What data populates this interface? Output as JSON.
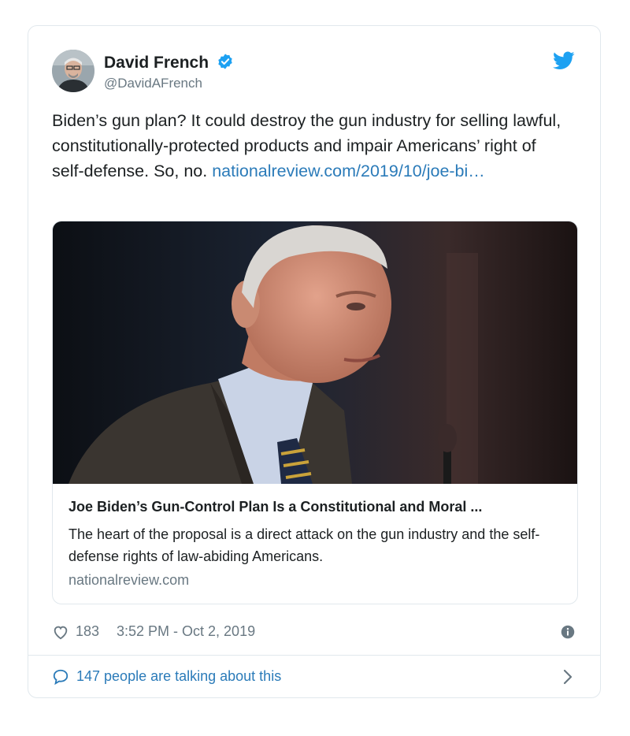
{
  "author": {
    "name": "David French",
    "handle": "@DavidAFrench"
  },
  "tweet": {
    "text": "Biden’s gun plan? It could destroy the gun industry for selling lawful, constitutionally-protected products and impair Americans’ right of self-defense. So, no.",
    "link_text": "nationalreview.com/2019/10/joe-bi…"
  },
  "card": {
    "title": "Joe Biden’s Gun-Control Plan Is a Constitutional and Moral ...",
    "description": "The heart of the proposal is a direct attack on the gun industry and the self-defense rights of law-abiding Americans.",
    "domain": "nationalreview.com"
  },
  "meta": {
    "likes": "183",
    "timestamp": "3:52 PM - Oct 2, 2019"
  },
  "footer": {
    "talking": "147 people are talking about this"
  },
  "colors": {
    "link": "#2b7bb9",
    "verified": "#1da1f2",
    "secondary_text": "#697882",
    "border": "#e1e8ed"
  },
  "icons": [
    "verified-badge-icon",
    "twitter-bird-icon",
    "heart-icon",
    "info-icon",
    "speech-bubble-icon",
    "chevron-right-icon"
  ]
}
